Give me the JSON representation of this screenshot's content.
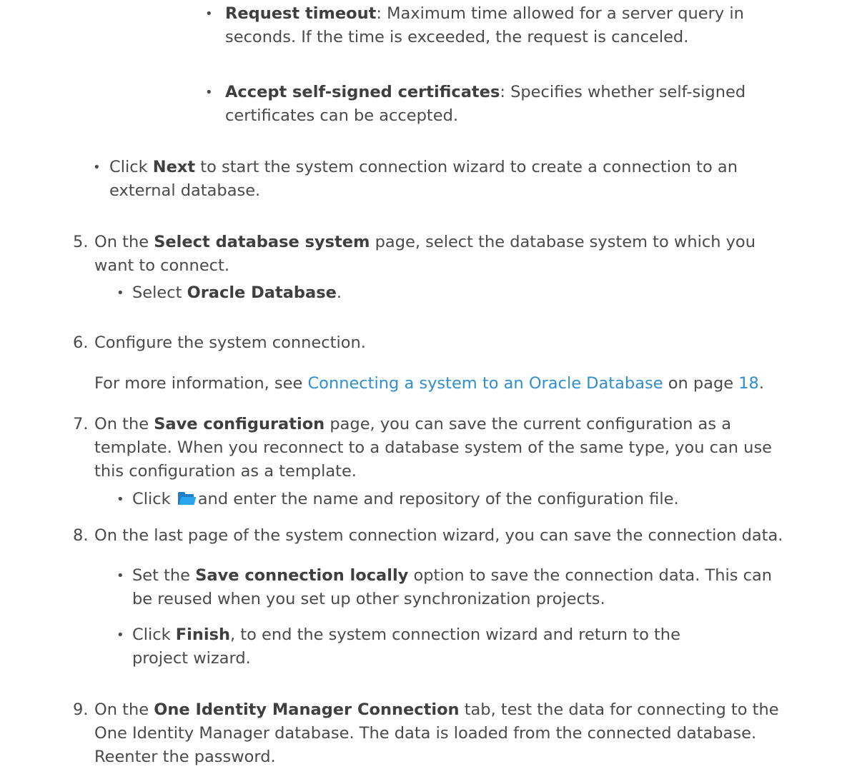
{
  "items": {
    "timeout": {
      "bold": "Request timeout",
      "line1": ": Maximum time allowed for a server query in",
      "line2": "seconds. If the time is exceeded, the request is canceled."
    },
    "selfsigned": {
      "bold": "Accept self-signed certificates",
      "line1": ": Specifies whether self-signed",
      "line2": "certificates can be accepted."
    },
    "next": {
      "pre": "Click ",
      "bold": "Next",
      "line1": " to start the system connection wizard to create a connection to an",
      "line2": "external database."
    },
    "step5": {
      "num": "5.",
      "pre": "On the ",
      "bold": "Select database system",
      "line1": " page, select the database system to which you",
      "line2": "want to connect.",
      "sub": {
        "pre": "Select ",
        "bold": "Oracle Database",
        "post": "."
      }
    },
    "step6": {
      "num": "6.",
      "line1": "Configure the system connection.",
      "info_pre": "For more information, see ",
      "info_link": "Connecting a system to an Oracle Database",
      "info_mid": " on page ",
      "info_page": "18",
      "info_post": "."
    },
    "step7": {
      "num": "7.",
      "pre": "On the ",
      "bold": "Save configuration",
      "line1": " page, you can save the current configuration as a",
      "line2": "template. When you reconnect to a database system of the same type, you can use",
      "line3": "this configuration as a template.",
      "sub_pre": "Click ",
      "sub_icon": "folder-open-icon",
      "sub_post": "and enter the name and repository of the configuration file."
    },
    "step8": {
      "num": "8.",
      "line1": "On the last page of the system connection wizard, you can save the connection data.",
      "sub1": {
        "pre": "Set the ",
        "bold": "Save connection locally",
        "line1": " option to save the connection data. This can",
        "line2": "be reused when you set up other synchronization projects."
      },
      "sub2": {
        "pre": "Click ",
        "bold": "Finish",
        "line1": ", to end the system connection wizard and return to the",
        "line2": "project wizard."
      }
    },
    "step9": {
      "num": "9.",
      "pre": "On the ",
      "bold": "One Identity Manager Connection",
      "line1": " tab, test the data for connecting to the",
      "line2": "One Identity Manager database. The data is loaded from the connected database.",
      "line3": "Reenter the password."
    }
  },
  "colors": {
    "text": "#4a4a4a",
    "link": "#2f8fcf",
    "folder_dark": "#1f7fc4",
    "folder_light": "#2aa6ef"
  }
}
